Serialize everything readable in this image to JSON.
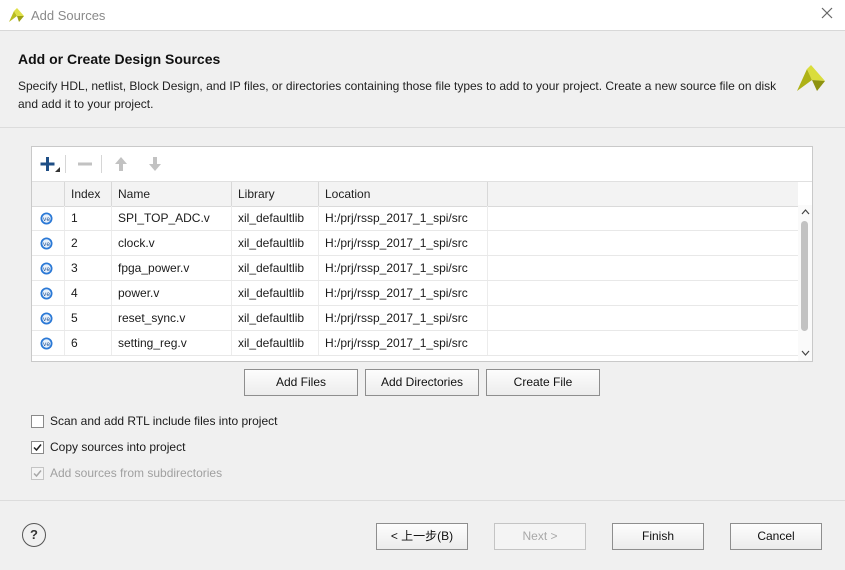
{
  "window": {
    "title": "Add Sources",
    "logo_icon": "vivado-logo-icon",
    "close_icon": "close-icon"
  },
  "header": {
    "title": "Add or Create Design Sources",
    "description": "Specify HDL, netlist, Block Design, and IP files, or directories containing those file types to add to your project. Create a new source file on disk and add it to your project."
  },
  "toolbar": {
    "icons": [
      "add-icon",
      "remove-icon",
      "move-up-icon",
      "move-down-icon"
    ]
  },
  "table": {
    "columns": [
      "",
      "Index",
      "Name",
      "Library",
      "Location"
    ],
    "rows": [
      {
        "index": "1",
        "name": "SPI_TOP_ADC.v",
        "library": "xil_defaultlib",
        "location": "H:/prj/rssp_2017_1_spi/src"
      },
      {
        "index": "2",
        "name": "clock.v",
        "library": "xil_defaultlib",
        "location": "H:/prj/rssp_2017_1_spi/src"
      },
      {
        "index": "3",
        "name": "fpga_power.v",
        "library": "xil_defaultlib",
        "location": "H:/prj/rssp_2017_1_spi/src"
      },
      {
        "index": "4",
        "name": "power.v",
        "library": "xil_defaultlib",
        "location": "H:/prj/rssp_2017_1_spi/src"
      },
      {
        "index": "5",
        "name": "reset_sync.v",
        "library": "xil_defaultlib",
        "location": "H:/prj/rssp_2017_1_spi/src"
      },
      {
        "index": "6",
        "name": "setting_reg.v",
        "library": "xil_defaultlib",
        "location": "H:/prj/rssp_2017_1_spi/src"
      }
    ],
    "file_icon": "verilog-file-icon"
  },
  "actions": {
    "add_files": "Add Files",
    "add_directories": "Add Directories",
    "create_file": "Create File"
  },
  "options": {
    "scan_rtl": {
      "label": "Scan and add RTL include files into project",
      "checked": false,
      "enabled": true
    },
    "copy_sources": {
      "label": "Copy sources into project",
      "checked": true,
      "enabled": true
    },
    "add_subdirs": {
      "label": "Add sources from subdirectories",
      "checked": true,
      "enabled": false
    }
  },
  "footer": {
    "help": "?",
    "back": "< 上一步(B)",
    "next": "Next >",
    "finish": "Finish",
    "cancel": "Cancel"
  },
  "colors": {
    "accent": "#2b79d6",
    "logo_yellow": "#c9cc2a"
  }
}
